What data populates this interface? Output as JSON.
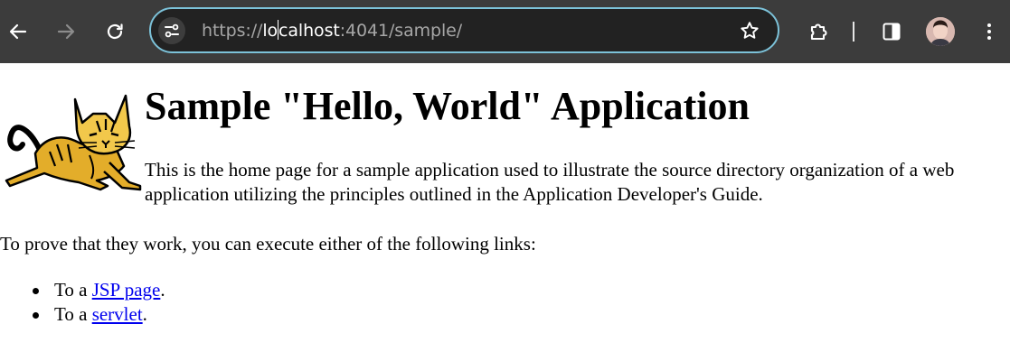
{
  "browser": {
    "url_scheme": "https://",
    "url_host": "localhost",
    "url_path": ":4041/sample/",
    "icons": [
      "back-arrow-icon",
      "forward-arrow-icon",
      "reload-icon",
      "site-info-icon",
      "bookmark-star-icon",
      "extensions-icon",
      "side-panel-icon",
      "kebab-menu-icon"
    ],
    "accent_color": "#7cc2d9"
  },
  "page": {
    "heading": "Sample \"Hello, World\" Application",
    "intro": "This is the home page for a sample application used to illustrate the source directory organization of a web application utilizing the principles outlined in the Application Developer's Guide.",
    "prove_text": "To prove that they work, you can execute either of the following links:",
    "links": [
      {
        "prefix": "To a ",
        "label": "JSP page",
        "suffix": "."
      },
      {
        "prefix": "To a ",
        "label": "servlet",
        "suffix": "."
      }
    ],
    "link_color": "#0000ee"
  }
}
